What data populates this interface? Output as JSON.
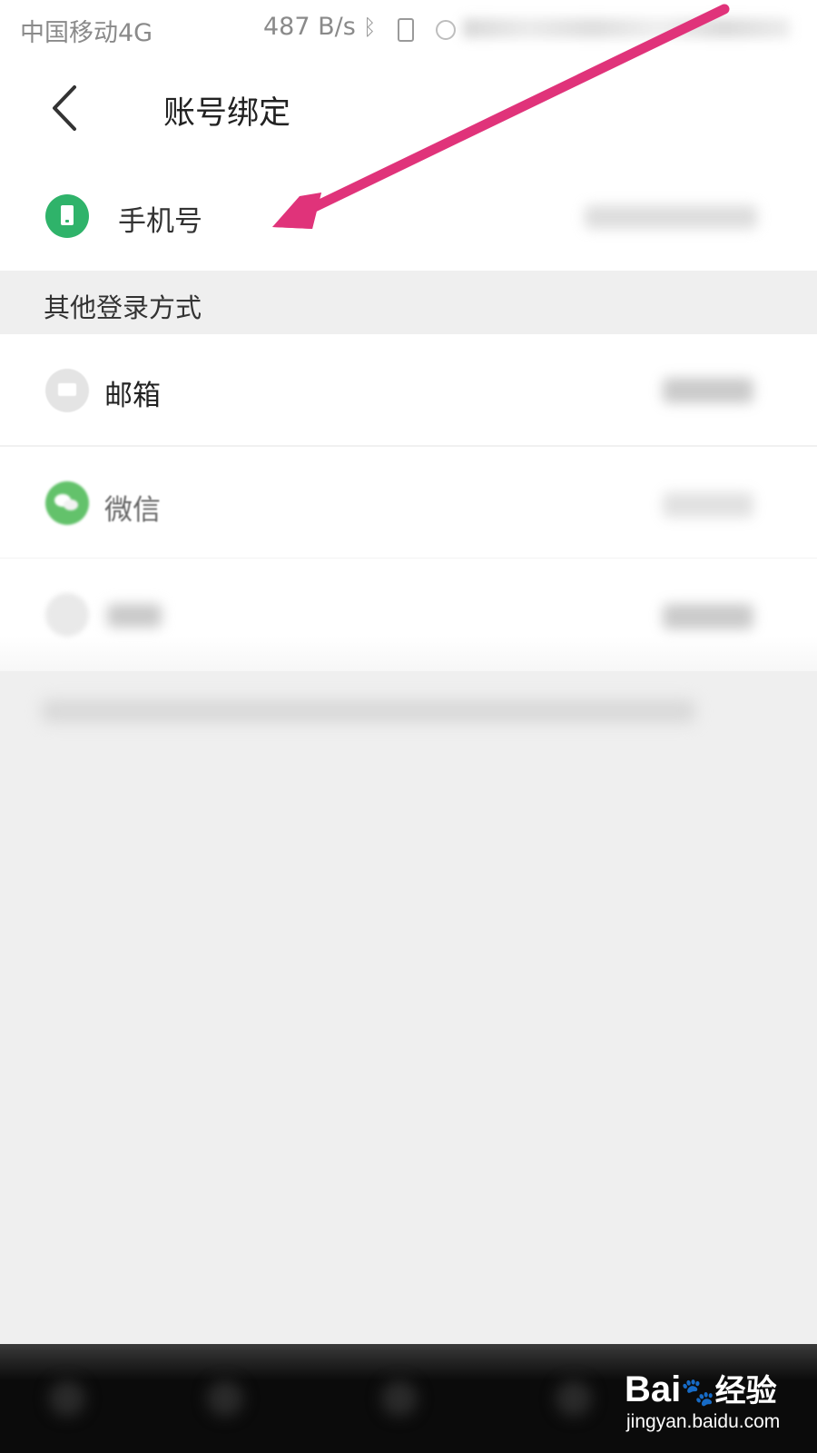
{
  "status_bar": {
    "carrier": "中国移动4G",
    "net_speed": "487 B/s",
    "bluetooth_icon": "bluetooth-icon",
    "vibrate_icon": "vibrate-icon",
    "alarm_icon": "alarm-icon"
  },
  "header": {
    "back_icon": "chevron-left-icon",
    "title": "账号绑定"
  },
  "phone_row": {
    "icon": "phone-icon",
    "icon_color": "#2fb36a",
    "label": "手机号"
  },
  "section": {
    "title": "其他登录方式"
  },
  "login_methods": [
    {
      "icon": "mail-icon",
      "label": "邮箱"
    },
    {
      "icon": "wechat-icon",
      "icon_color": "#63c26b",
      "label": "微信"
    }
  ],
  "annotation": {
    "arrow_color": "#e0337a"
  },
  "watermark": {
    "logo": "Bai",
    "logo_cn": "经验",
    "url": "jingyan.baidu.com"
  }
}
